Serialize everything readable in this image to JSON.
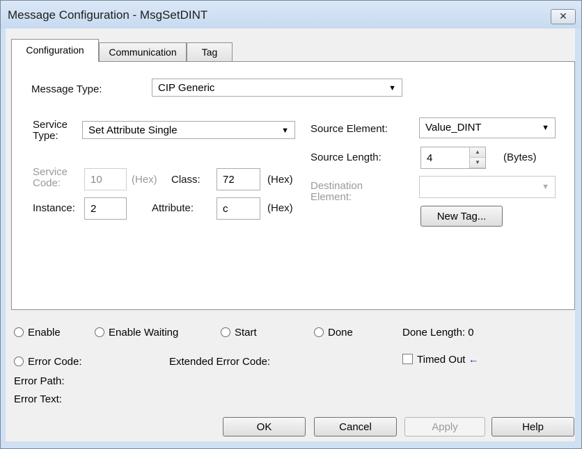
{
  "window": {
    "title": "Message Configuration - MsgSetDINT",
    "close_glyph": "✕"
  },
  "tabs": [
    {
      "label": "Configuration",
      "active": true
    },
    {
      "label": "Communication",
      "active": false
    },
    {
      "label": "Tag",
      "active": false
    }
  ],
  "config": {
    "message_type_label": "Message Type:",
    "message_type_value": "CIP Generic",
    "service_type_label_1": "Service",
    "service_type_label_2": "Type:",
    "service_type_value": "Set Attribute Single",
    "service_code_label_1": "Service",
    "service_code_label_2": "Code:",
    "service_code_value": "10",
    "service_code_unit": "(Hex)",
    "class_label": "Class:",
    "class_value": "72",
    "class_unit": "(Hex)",
    "instance_label": "Instance:",
    "instance_value": "2",
    "attribute_label": "Attribute:",
    "attribute_value": "c",
    "attribute_unit": "(Hex)",
    "source_element_label": "Source Element:",
    "source_element_value": "Value_DINT",
    "source_length_label": "Source Length:",
    "source_length_value": "4",
    "source_length_unit": "(Bytes)",
    "destination_label_1": "Destination",
    "destination_label_2": "Element:",
    "destination_value": "",
    "new_tag_label": "New Tag..."
  },
  "status": {
    "enable": "Enable",
    "enable_waiting": "Enable Waiting",
    "start": "Start",
    "done": "Done",
    "done_length_label": "Done Length:",
    "done_length_value": "0",
    "error_code": "Error Code:",
    "extended_error_code": "Extended Error Code:",
    "timed_out": "Timed Out",
    "timed_out_arrow": "←",
    "error_path": "Error Path:",
    "error_text": "Error Text:"
  },
  "buttons": {
    "ok": "OK",
    "cancel": "Cancel",
    "apply": "Apply",
    "help": "Help"
  },
  "colors": {
    "title_bg": "#cfe0f3",
    "arrow": "#1a3fb8"
  }
}
